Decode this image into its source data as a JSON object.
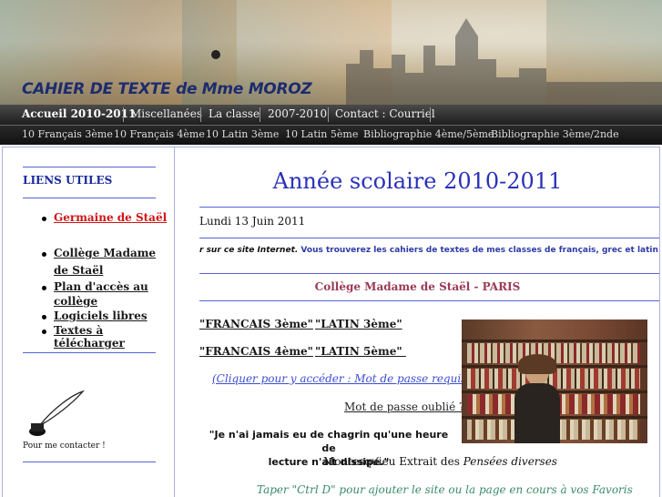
{
  "banner": {
    "title": "CAHIER DE TEXTE de Mme MOROZ"
  },
  "nav_primary": [
    "Accueil 2010-2011",
    "Miscellanées",
    "La classe",
    "2007-2010",
    "Contact : Courriel"
  ],
  "nav_secondary": [
    "10 Français 3ème",
    "10 Français 4ème",
    "10 Latin 3ème",
    "10 Latin 5ème",
    "Bibliographie 4ème/5ème",
    "Bibliographie 3ème/2nde"
  ],
  "sidebar": {
    "heading": "LIENS UTILES",
    "links": [
      "Germaine de Staël",
      "Collège Madame",
      "de Staël",
      "Plan d'accès au",
      "collège",
      "Logiciels libres",
      "Textes à télécharger"
    ],
    "contact": "Pour me contacter !"
  },
  "main": {
    "title": "Année scolaire 2010-2011",
    "date": "Lundi 13 Juin 2011",
    "marquee_em": "r sur ce site Internet.",
    "marquee_text": " Vous trouverez les cahiers de textes de mes classes de français, grec et latin le cas échéant.",
    "college": "Collège Madame de Staël - PARIS",
    "class_links": [
      "\"FRANCAIS 3ème\"",
      "\"LATIN 3ème\"",
      "\"FRANCAIS 4ème\"",
      "\"LATIN 5ème\" "
    ],
    "access": "(Cliquer pour y accéder : Mot de passe requis)",
    "forgot": "Mot de passe oublié ?",
    "quote_line1": "\"Je n'ai jamais eu de chagrin qu'une heure de",
    "quote_line2": "lecture n'ait dissipé.\"",
    "attribution": "Montesquieu Extrait des",
    "attribution_work": "Pensées diverses",
    "favorites": "Taper \"Ctrl D\" pour ajouter le site ou la page en cours à vos Favoris"
  }
}
